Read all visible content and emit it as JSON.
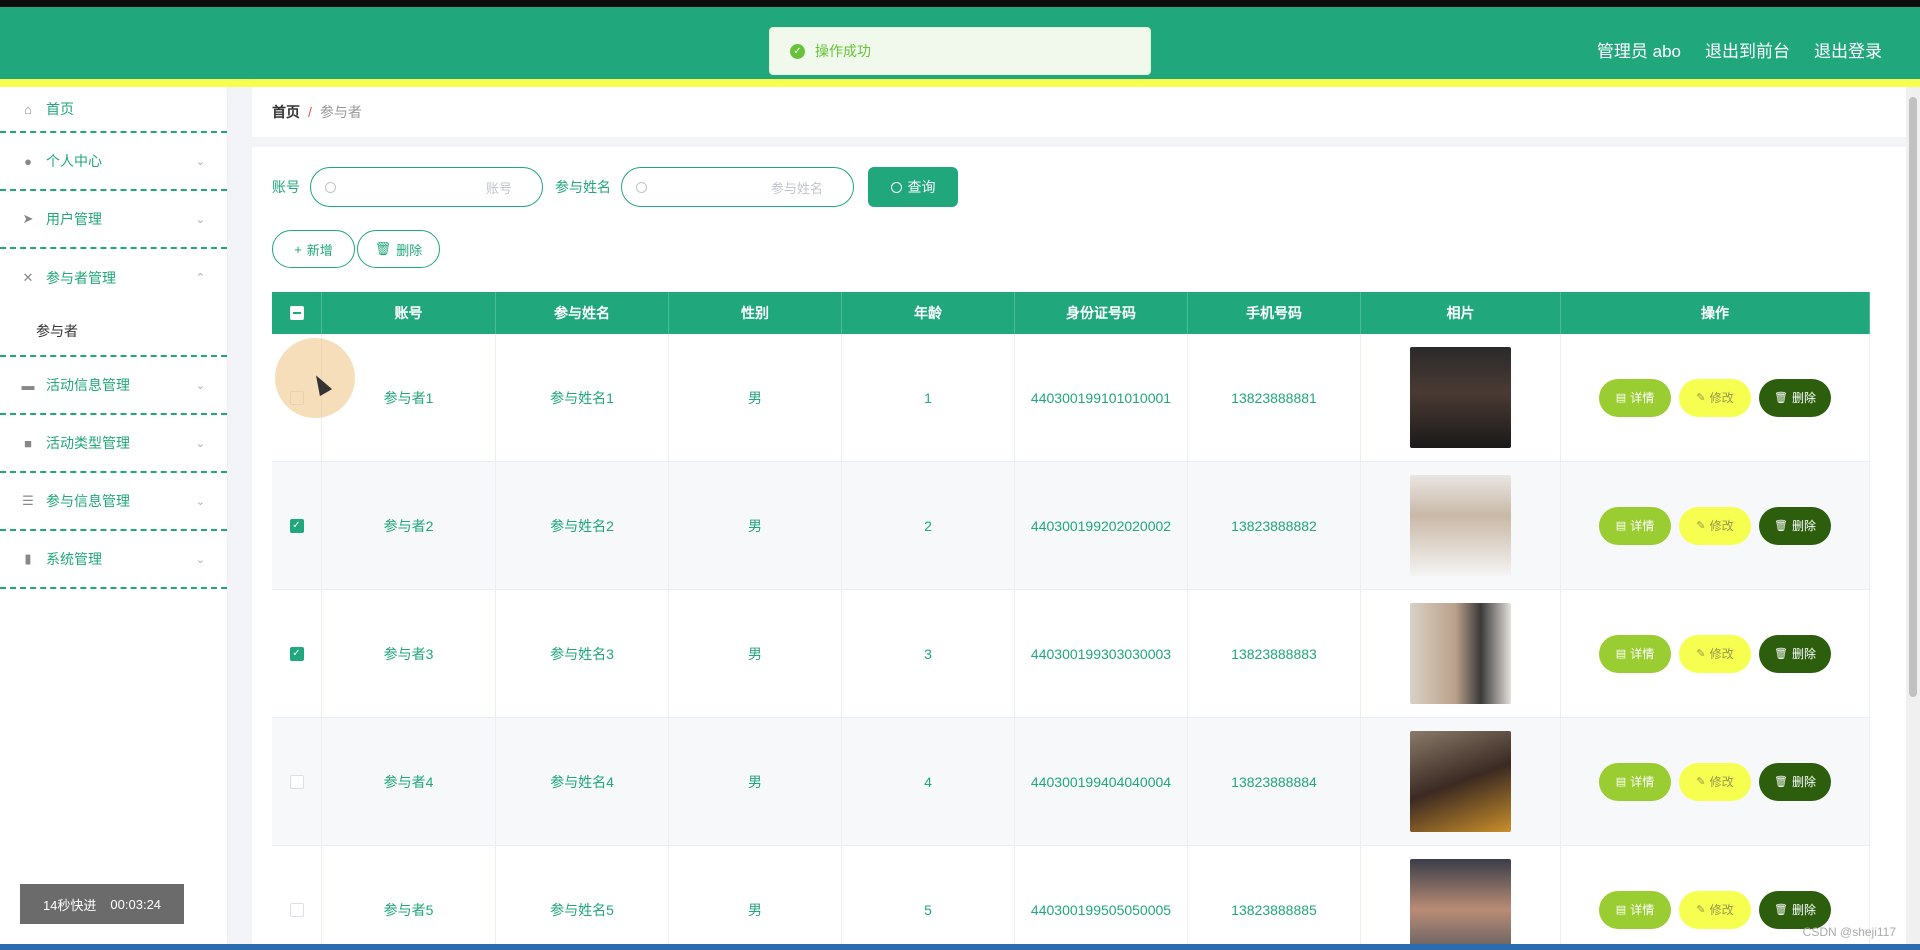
{
  "header": {
    "admin_label": "管理员 abo",
    "link_front": "退出到前台",
    "link_logout": "退出登录"
  },
  "toast": {
    "message": "操作成功"
  },
  "sidebar": {
    "items": [
      {
        "label": "首页",
        "icon": "home-icon"
      },
      {
        "label": "个人中心",
        "icon": "user-icon"
      },
      {
        "label": "用户管理",
        "icon": "send-icon"
      },
      {
        "label": "参与者管理",
        "icon": "bell-off-icon"
      },
      {
        "label": "活动信息管理",
        "icon": "chat-icon"
      },
      {
        "label": "活动类型管理",
        "icon": "briefcase-icon"
      },
      {
        "label": "参与信息管理",
        "icon": "list-icon"
      },
      {
        "label": "系统管理",
        "icon": "chart-icon"
      }
    ],
    "sub_active": "参与者"
  },
  "breadcrumb": {
    "home": "首页",
    "separator": "/",
    "current": "参与者"
  },
  "search": {
    "account_label": "账号",
    "account_placeholder": "账号",
    "name_label": "参与姓名",
    "name_placeholder": "参与姓名",
    "query_button": "查询"
  },
  "actions": {
    "add": "新增",
    "delete": "删除"
  },
  "table": {
    "headers": [
      "账号",
      "参与姓名",
      "性别",
      "年龄",
      "身份证号码",
      "手机号码",
      "相片",
      "操作"
    ],
    "rows": [
      {
        "account": "参与者1",
        "name": "参与姓名1",
        "gender": "男",
        "age": "1",
        "idcard": "440300199101010001",
        "phone": "13823888881",
        "checked": false
      },
      {
        "account": "参与者2",
        "name": "参与姓名2",
        "gender": "男",
        "age": "2",
        "idcard": "440300199202020002",
        "phone": "13823888882",
        "checked": true
      },
      {
        "account": "参与者3",
        "name": "参与姓名3",
        "gender": "男",
        "age": "3",
        "idcard": "440300199303030003",
        "phone": "13823888883",
        "checked": true
      },
      {
        "account": "参与者4",
        "name": "参与姓名4",
        "gender": "男",
        "age": "4",
        "idcard": "440300199404040004",
        "phone": "13823888884",
        "checked": false
      },
      {
        "account": "参与者5",
        "name": "参与姓名5",
        "gender": "男",
        "age": "5",
        "idcard": "440300199505050005",
        "phone": "13823888885",
        "checked": false
      }
    ],
    "op_detail": "详情",
    "op_edit": "修改",
    "op_delete": "删除"
  },
  "video_badge": {
    "speed": "14秒快进",
    "time": "00:03:24"
  },
  "watermark": "CSDN @sheji117",
  "colors": {
    "primary": "#20a77b",
    "accent_yellow": "#f6ff4f",
    "detail": "#9acd32",
    "delete": "#2c5e0e"
  }
}
